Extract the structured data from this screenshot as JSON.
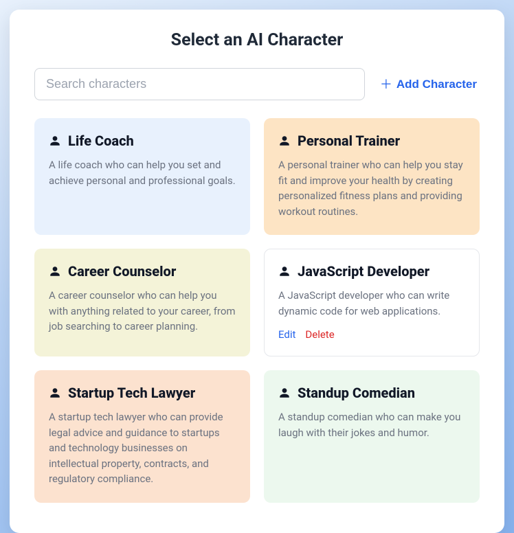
{
  "title": "Select an AI Character",
  "search": {
    "placeholder": "Search characters"
  },
  "addCharacter": {
    "label": "Add Character"
  },
  "actions": {
    "edit": "Edit",
    "delete": "Delete"
  },
  "cards": [
    {
      "name": "Life Coach",
      "description": "A life coach who can help you set and achieve personal and professional goals.",
      "colorClass": "c-blue",
      "showActions": false
    },
    {
      "name": "Personal Trainer",
      "description": "A personal trainer who can help you stay fit and improve your health by creating personalized fitness plans and providing workout routines.",
      "colorClass": "c-orange",
      "showActions": false
    },
    {
      "name": "Career Counselor",
      "description": "A career counselor who can help you with anything related to your career, from job searching to career planning.",
      "colorClass": "c-yellow",
      "showActions": false
    },
    {
      "name": "JavaScript Developer",
      "description": "A JavaScript developer who can write dynamic code for web applications.",
      "colorClass": "c-white",
      "showActions": true
    },
    {
      "name": "Startup Tech Lawyer",
      "description": "A startup tech lawyer who can provide legal advice and guidance to startups and technology businesses on intellectual property, contracts, and regulatory compliance.",
      "colorClass": "c-peach",
      "showActions": false
    },
    {
      "name": "Standup Comedian",
      "description": "A standup comedian who can make you laugh with their jokes and humor.",
      "colorClass": "c-green",
      "showActions": false
    }
  ]
}
